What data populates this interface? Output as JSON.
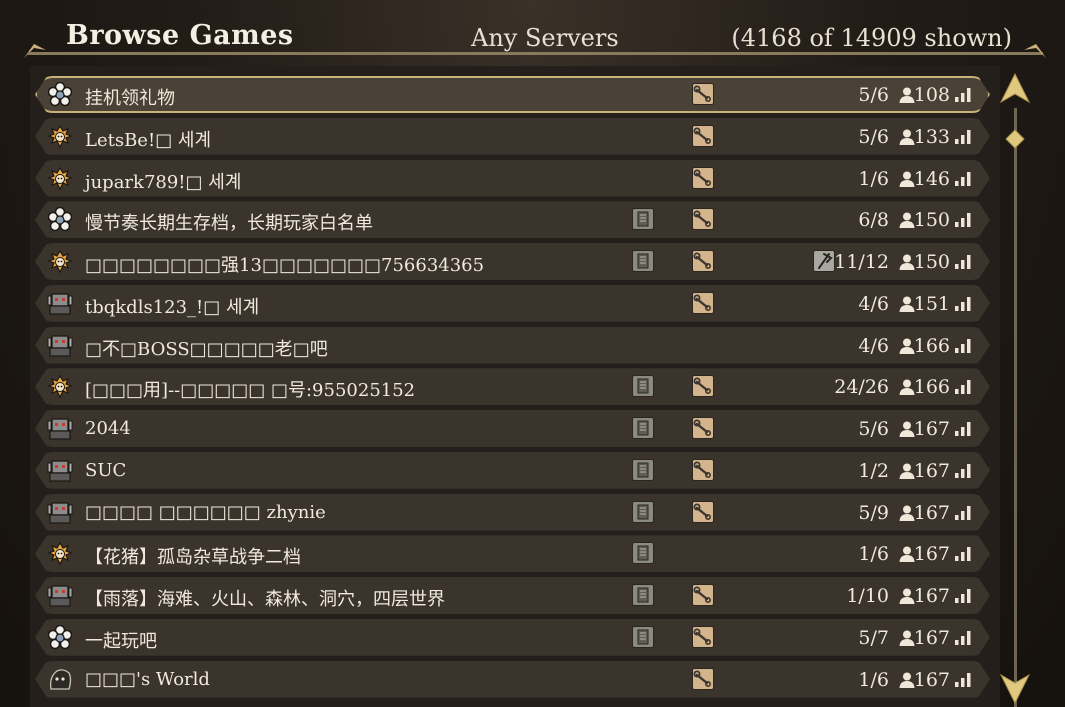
{
  "header": {
    "title": "Browse Games",
    "filter_label": "Any Servers",
    "count_label": "(4168 of 14909 shown)"
  },
  "colors": {
    "accent_gold": "#c8b27a",
    "row_bg": "#3a342d",
    "mods_icon_bg": "#d4b48c",
    "server_icon_bg": "#8a8a80"
  },
  "servers": [
    {
      "name": "挂机领礼物",
      "icon": "flower-character-icon",
      "dedicated": false,
      "mods": true,
      "pvp": false,
      "players": "5/6",
      "ping": "108",
      "selected": true
    },
    {
      "name": "LetsBe!□ 세계",
      "icon": "wilson-character-icon",
      "dedicated": false,
      "mods": true,
      "pvp": false,
      "players": "5/6",
      "ping": "133",
      "selected": false
    },
    {
      "name": "jupark789!□ 세계",
      "icon": "wilson-character-icon",
      "dedicated": false,
      "mods": true,
      "pvp": false,
      "players": "1/6",
      "ping": "146",
      "selected": false
    },
    {
      "name": "慢节奏长期生存档，长期玩家白名单",
      "icon": "flower-character-icon",
      "dedicated": true,
      "mods": true,
      "pvp": false,
      "players": "6/8",
      "ping": "150",
      "selected": false
    },
    {
      "name": "□□□□□□□□强13□□□□□□□756634365",
      "icon": "wilson-character-icon",
      "dedicated": true,
      "mods": true,
      "pvp": true,
      "players": "11/12",
      "ping": "150",
      "selected": false
    },
    {
      "name": "tbqkdls123_!□ 세계",
      "icon": "wx78-character-icon",
      "dedicated": false,
      "mods": true,
      "pvp": false,
      "players": "4/6",
      "ping": "151",
      "selected": false
    },
    {
      "name": "□不□BOSS□□□□□老□吧",
      "icon": "wx78-character-icon",
      "dedicated": false,
      "mods": false,
      "pvp": false,
      "players": "4/6",
      "ping": "166",
      "selected": false
    },
    {
      "name": "[□□□用]--□□□□□ □号:955025152",
      "icon": "wilson-character-icon",
      "dedicated": true,
      "mods": true,
      "pvp": false,
      "players": "24/26",
      "ping": "166",
      "selected": false
    },
    {
      "name": "2044",
      "icon": "wx78-character-icon",
      "dedicated": true,
      "mods": true,
      "pvp": false,
      "players": "5/6",
      "ping": "167",
      "selected": false
    },
    {
      "name": "SUC",
      "icon": "wx78-character-icon",
      "dedicated": true,
      "mods": true,
      "pvp": false,
      "players": "1/2",
      "ping": "167",
      "selected": false
    },
    {
      "name": "□□□□ □□□□□□ zhynie",
      "icon": "wx78-character-icon",
      "dedicated": true,
      "mods": true,
      "pvp": false,
      "players": "5/9",
      "ping": "167",
      "selected": false
    },
    {
      "name": "【花猪】孤岛杂草战争二档",
      "icon": "wilson-character-icon",
      "dedicated": true,
      "mods": false,
      "pvp": false,
      "players": "1/6",
      "ping": "167",
      "selected": false
    },
    {
      "name": "【雨落】海难、火山、森林、洞穴，四层世界",
      "icon": "wx78-character-icon",
      "dedicated": true,
      "mods": true,
      "pvp": false,
      "players": "1/10",
      "ping": "167",
      "selected": false
    },
    {
      "name": "一起玩吧",
      "icon": "flower-character-icon",
      "dedicated": true,
      "mods": true,
      "pvp": false,
      "players": "5/7",
      "ping": "167",
      "selected": false
    },
    {
      "name": "□□□'s World",
      "icon": "webber-character-icon",
      "dedicated": false,
      "mods": true,
      "pvp": false,
      "players": "1/6",
      "ping": "167",
      "selected": false
    }
  ],
  "scroll": {
    "position_fraction": 0.02
  }
}
